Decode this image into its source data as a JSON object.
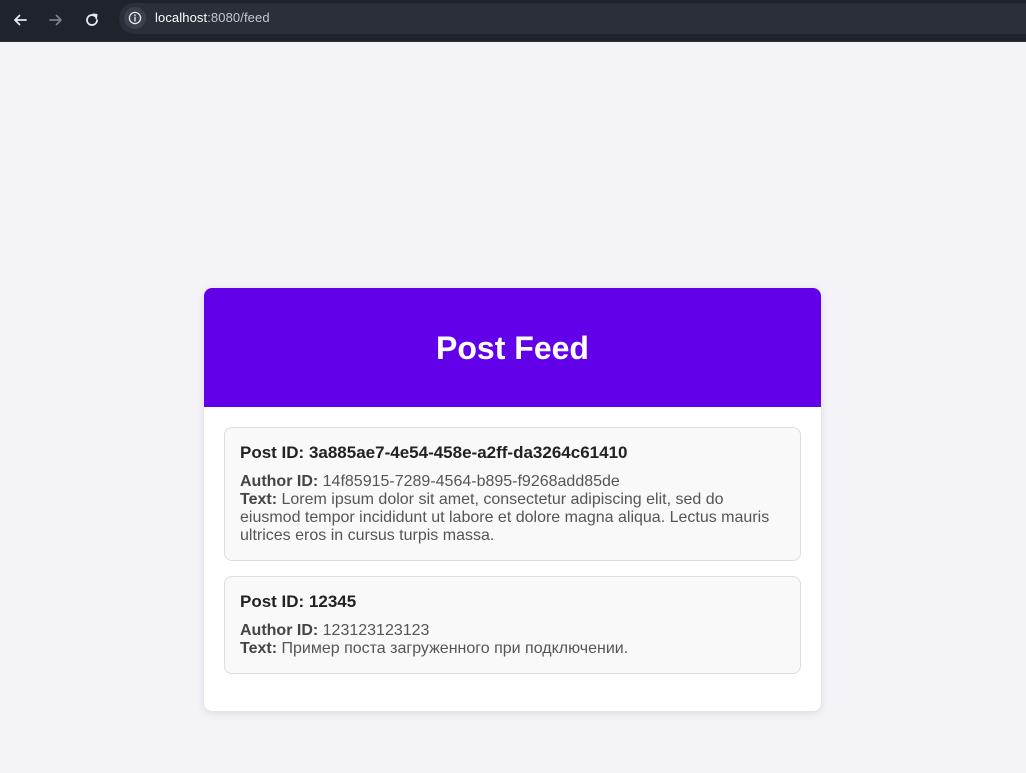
{
  "browser": {
    "url_host": "localhost",
    "url_rest": ":8080/feed"
  },
  "page": {
    "title": "Post Feed"
  },
  "posts": [
    {
      "id_label": "Post ID: 3a885ae7-4e54-458e-a2ff-da3264c61410",
      "author_label": "Author ID:",
      "author_id": "14f85915-7289-4564-b895-f9268add85de",
      "text_label": "Text:",
      "text": "Lorem ipsum dolor sit amet, consectetur adipiscing elit, sed do eiusmod tempor incididunt ut labore et dolore magna aliqua. Lectus mauris ultrices eros in cursus turpis massa."
    },
    {
      "id_label": "Post ID: 12345",
      "author_label": "Author ID:",
      "author_id": "123123123123",
      "text_label": "Text:",
      "text": "Пример поста загруженного при подключении."
    }
  ],
  "colors": {
    "header_bg": "#6200ea",
    "page_bg": "#f4f3f8",
    "browser_bar": "#1f232c"
  },
  "icons": {
    "back": "arrow-left-icon",
    "forward": "arrow-right-icon",
    "reload": "reload-icon",
    "site_info": "info-icon"
  }
}
